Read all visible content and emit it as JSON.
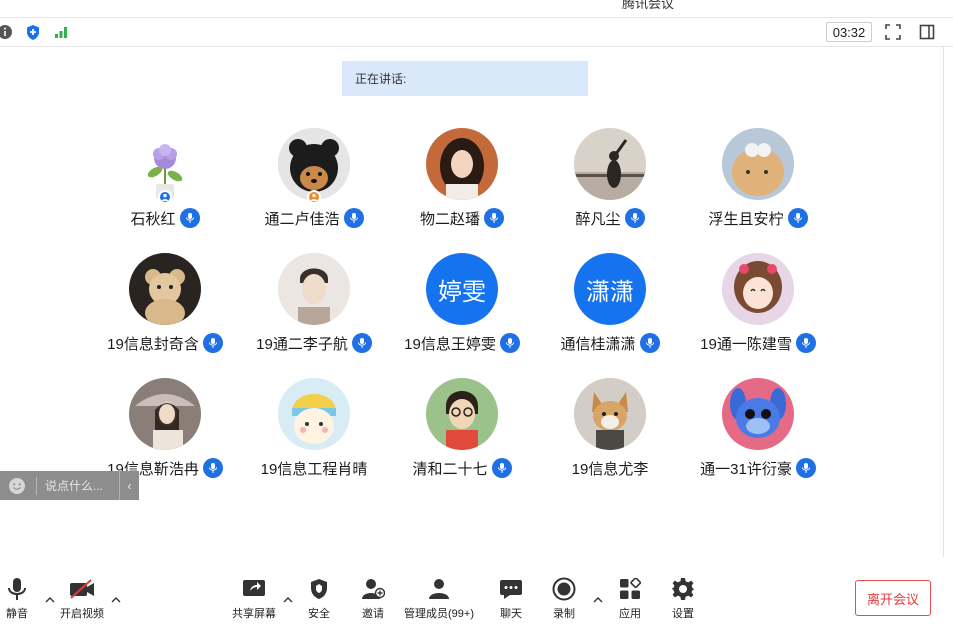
{
  "window": {
    "title": "腾讯会议"
  },
  "topbar": {
    "timer": "03:32"
  },
  "speaking": {
    "label": "正在讲话:"
  },
  "participants": [
    {
      "name": "石秋红",
      "avatar_text": ""
    },
    {
      "name": "通二卢佳浩",
      "avatar_text": ""
    },
    {
      "name": "物二赵璠",
      "avatar_text": ""
    },
    {
      "name": "醉凡尘",
      "avatar_text": ""
    },
    {
      "name": "浮生且安柠",
      "avatar_text": ""
    },
    {
      "name": "19信息封奇含",
      "avatar_text": ""
    },
    {
      "name": "19通二李子航",
      "avatar_text": ""
    },
    {
      "name": "19信息王婷雯",
      "avatar_text": "婷雯"
    },
    {
      "name": "通信桂潇潇",
      "avatar_text": "潇潇"
    },
    {
      "name": "19通一陈建雪",
      "avatar_text": ""
    },
    {
      "name": "19信息靳浩冉",
      "avatar_text": ""
    },
    {
      "name": "19信息工程肖晴",
      "avatar_text": ""
    },
    {
      "name": "清和二十七",
      "avatar_text": ""
    },
    {
      "name": "19信息尤李",
      "avatar_text": ""
    },
    {
      "name": "通一31许衍豪",
      "avatar_text": ""
    }
  ],
  "chat": {
    "placeholder": "说点什么..."
  },
  "toolbar": {
    "mute": "静音",
    "video": "开启视频",
    "share": "共享屏幕",
    "security": "安全",
    "invite": "邀请",
    "members": "管理成员(99+)",
    "chat": "聊天",
    "record": "录制",
    "apps": "应用",
    "settings": "设置",
    "leave": "离开会议"
  },
  "colors": {
    "accent": "#1673f0",
    "leave": "#e03b3b",
    "speaking_bg": "#d9e8fb"
  }
}
